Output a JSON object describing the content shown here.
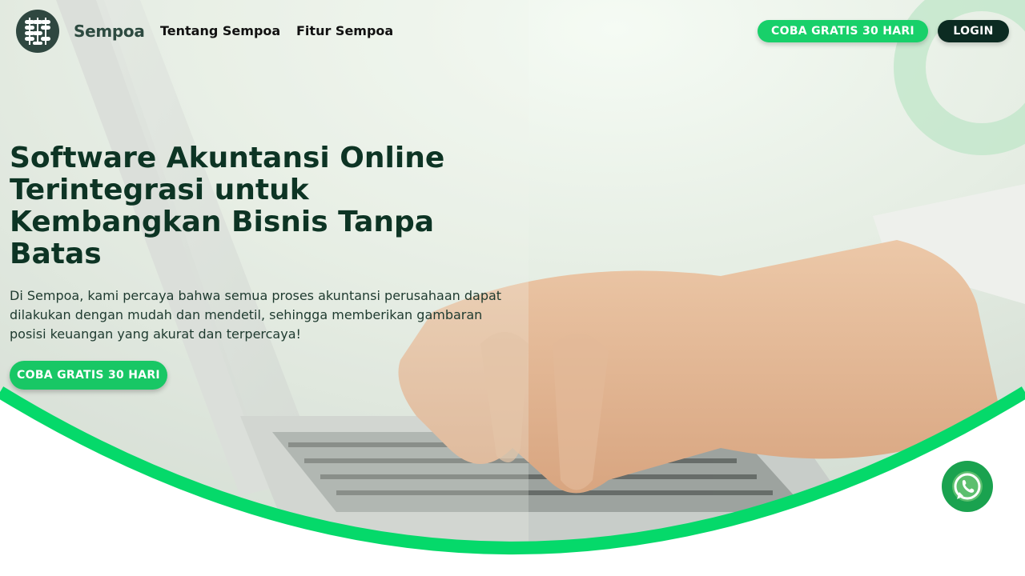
{
  "brand": {
    "name": "Sempoa"
  },
  "nav": {
    "links": [
      "Tentang Sempoa",
      "Fitur Sempoa"
    ],
    "try_label": "COBA GRATIS 30 HARI",
    "login_label": "LOGIN"
  },
  "hero": {
    "headline": "Software Akuntansi Online Terintegrasi untuk Kembangkan Bisnis Tanpa Batas",
    "subtext": "Di Sempoa, kami percaya bahwa semua proses akuntansi perusahaan dapat dilakukan dengan mudah dan mendetil, sehingga memberikan gambaran posisi keuangan yang akurat dan terpercaya!",
    "cta_label": "COBA GRATIS 30 HARI"
  },
  "colors": {
    "accent_green": "#18d06a",
    "dark_green": "#0c2b22",
    "headline": "#0d3424",
    "whatsapp": "#1aa24f"
  },
  "icons": {
    "logo": "abacus-logo-icon",
    "whatsapp": "whatsapp-icon"
  }
}
